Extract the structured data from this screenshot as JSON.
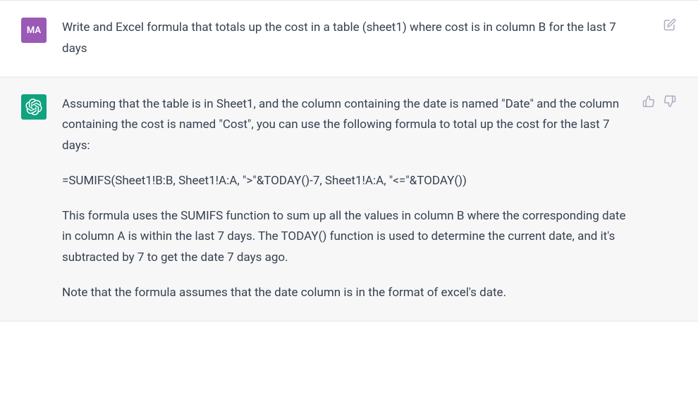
{
  "user": {
    "avatar_text": "MA",
    "message": "Write and Excel formula that totals up the cost in a table (sheet1) where cost is in column B for the last 7 days"
  },
  "assistant": {
    "paragraph1": "Assuming that the table is in Sheet1, and the column containing the date is named \"Date\" and the column containing the cost is named \"Cost\", you can use the following formula to total up the cost for the last 7 days:",
    "formula": "=SUMIFS(Sheet1!B:B, Sheet1!A:A, \">\"&TODAY()-7, Sheet1!A:A, \"<=\"&TODAY())",
    "paragraph2": "This formula uses the SUMIFS function to sum up all the values in column B where the corresponding date in column A is within the last 7 days. The TODAY() function is used to determine the current date, and it's subtracted by 7 to get the date 7 days ago.",
    "paragraph3": "Note that the formula assumes that the date column is in the format of excel's date."
  }
}
